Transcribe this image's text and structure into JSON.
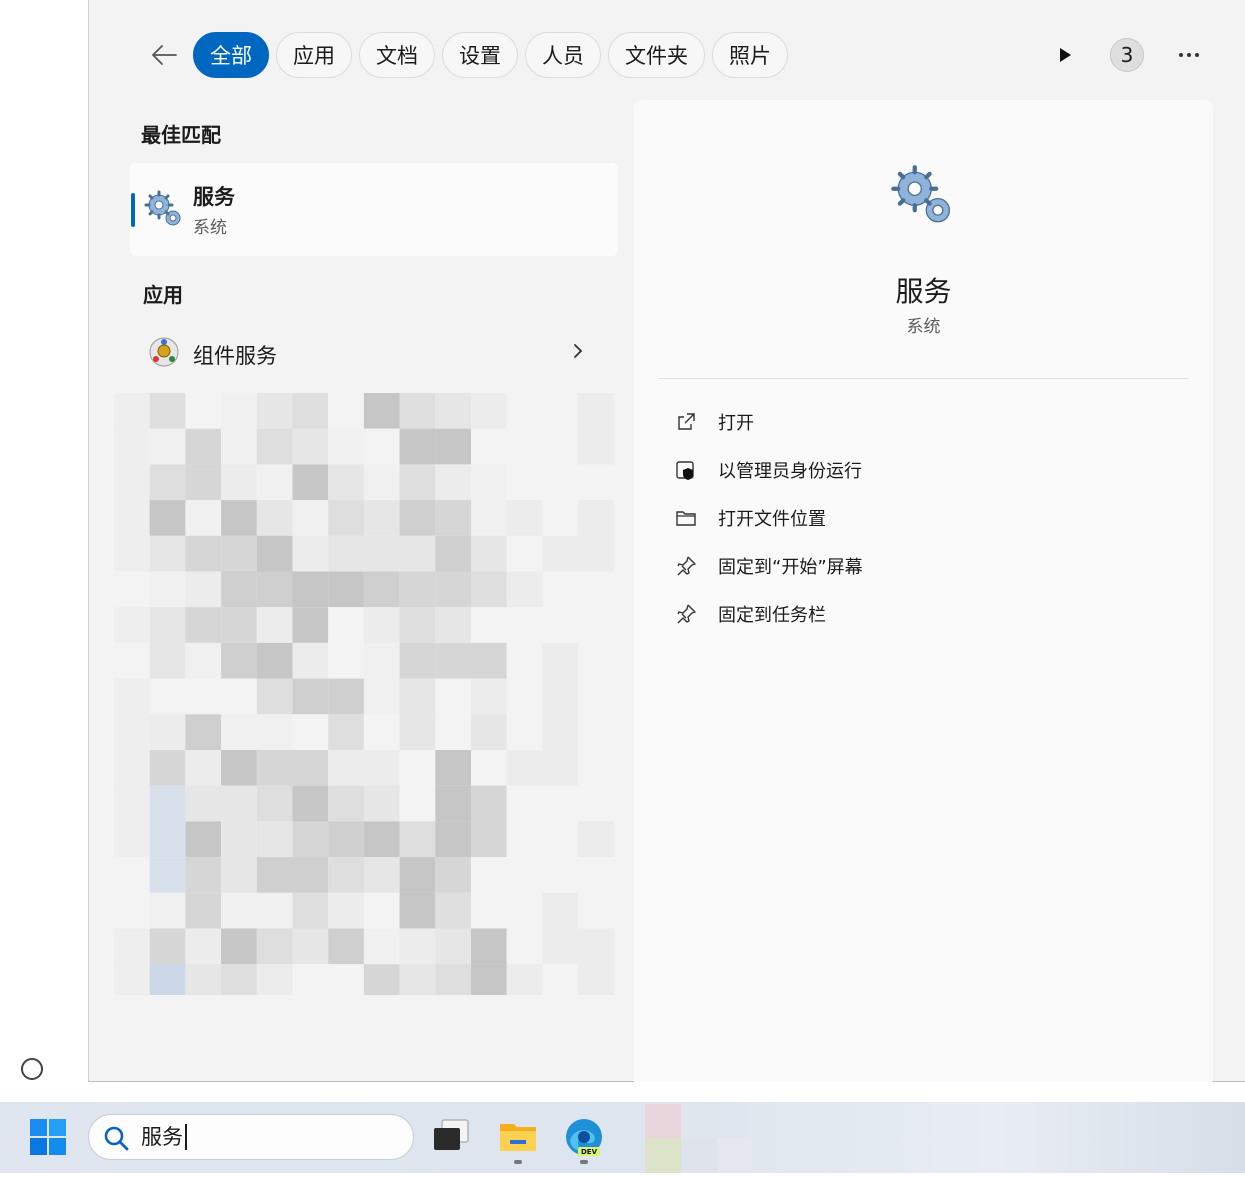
{
  "filters": {
    "tabs": [
      {
        "label": "全部",
        "active": true
      },
      {
        "label": "应用",
        "active": false
      },
      {
        "label": "文档",
        "active": false
      },
      {
        "label": "设置",
        "active": false
      },
      {
        "label": "人员",
        "active": false
      },
      {
        "label": "文件夹",
        "active": false
      },
      {
        "label": "照片",
        "active": false
      }
    ],
    "badge_count": "3"
  },
  "best_match": {
    "heading": "最佳匹配",
    "name": "服务",
    "type": "系统",
    "icon": "gears-icon"
  },
  "apps": {
    "heading": "应用",
    "items": [
      {
        "name": "组件服务",
        "icon": "component-services-icon"
      }
    ]
  },
  "detail": {
    "title": "服务",
    "subtitle": "系统",
    "actions": [
      {
        "label": "打开",
        "icon": "open-external-icon"
      },
      {
        "label": "以管理员身份运行",
        "icon": "shield-admin-icon"
      },
      {
        "label": "打开文件位置",
        "icon": "folder-icon"
      },
      {
        "label": "固定到“开始”屏幕",
        "icon": "pin-icon"
      },
      {
        "label": "固定到任务栏",
        "icon": "pin-icon"
      }
    ]
  },
  "taskbar": {
    "search_value": "服务"
  },
  "colors": {
    "accent": "#0067c0",
    "panel": "#f3f3f3",
    "detail": "#fafafa"
  }
}
